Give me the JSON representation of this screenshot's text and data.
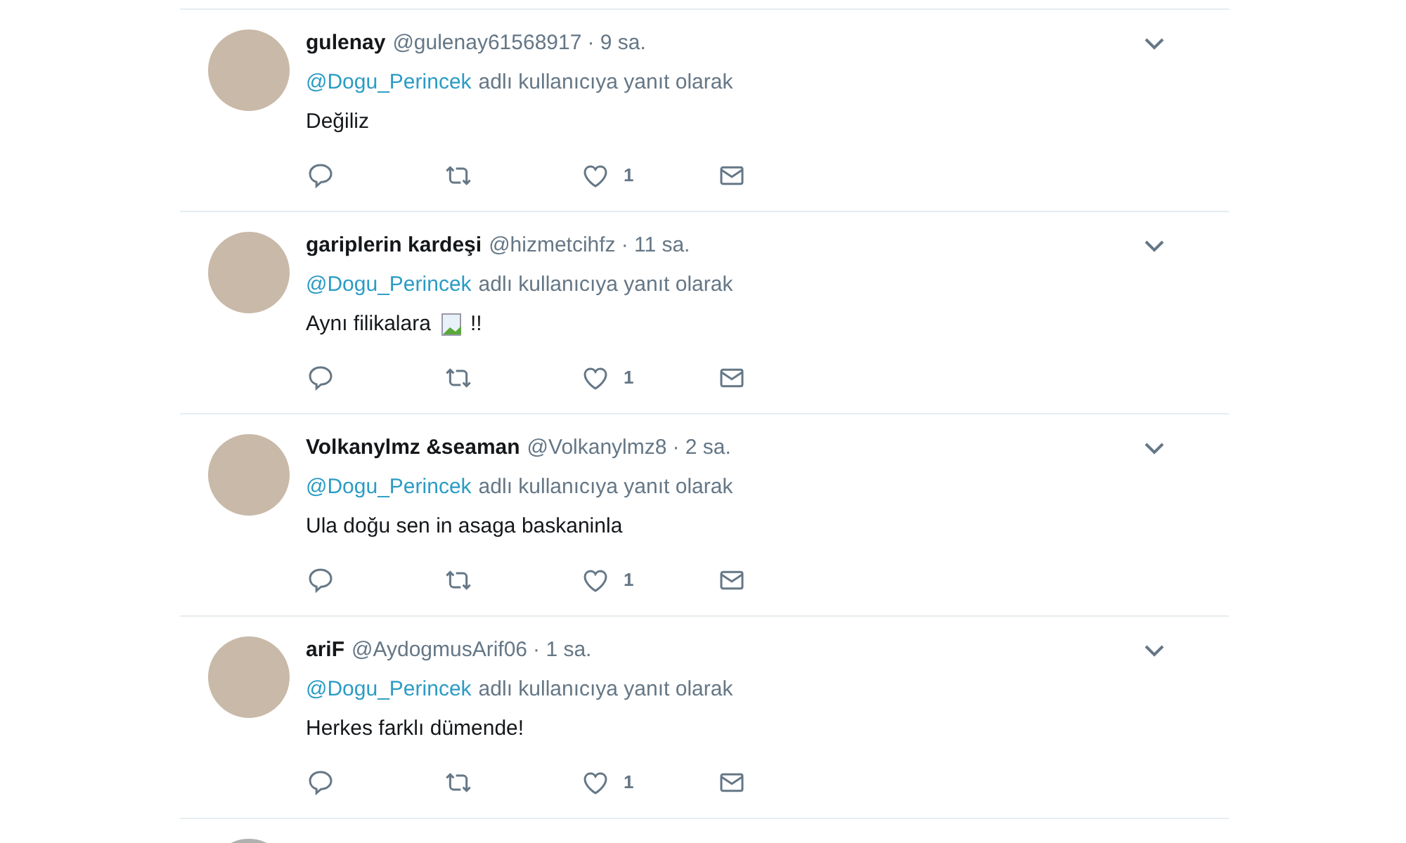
{
  "tweets": [
    {
      "name": "gulenay",
      "handle": "@gulenay61568917",
      "time": "· 9 sa.",
      "mention": "@Dogu_Perincek",
      "reply_text": "adlı kullanıcıya yanıt olarak",
      "body": [
        {
          "kind": "text",
          "text": "Değiliz"
        }
      ],
      "likes": "1"
    },
    {
      "name": "gariplerin kardeşi",
      "handle": "@hizmetcihfz",
      "time": "· 11 sa.",
      "mention": "@Dogu_Perincek",
      "reply_text": "adlı kullanıcıya yanıt olarak",
      "body": [
        {
          "kind": "text",
          "text": "Aynı filikalara"
        },
        {
          "kind": "broken_image"
        },
        {
          "kind": "text",
          "text": "!!"
        }
      ],
      "likes": "1"
    },
    {
      "name": "Volkanylmz &seaman",
      "handle": "@Volkanylmz8",
      "time": "· 2 sa.",
      "mention": "@Dogu_Perincek",
      "reply_text": "adlı kullanıcıya yanıt olarak",
      "body": [
        {
          "kind": "text",
          "text": "Ula doğu sen in asaga baskaninla"
        }
      ],
      "likes": "1"
    },
    {
      "name": "ariF",
      "handle": "@AydogmusArif06",
      "time": "· 1 sa.",
      "mention": "@Dogu_Perincek",
      "reply_text": "adlı kullanıcıya yanıt olarak",
      "body": [
        {
          "kind": "text",
          "text": "Herkes farklı dümende!"
        }
      ],
      "likes": "1"
    }
  ]
}
